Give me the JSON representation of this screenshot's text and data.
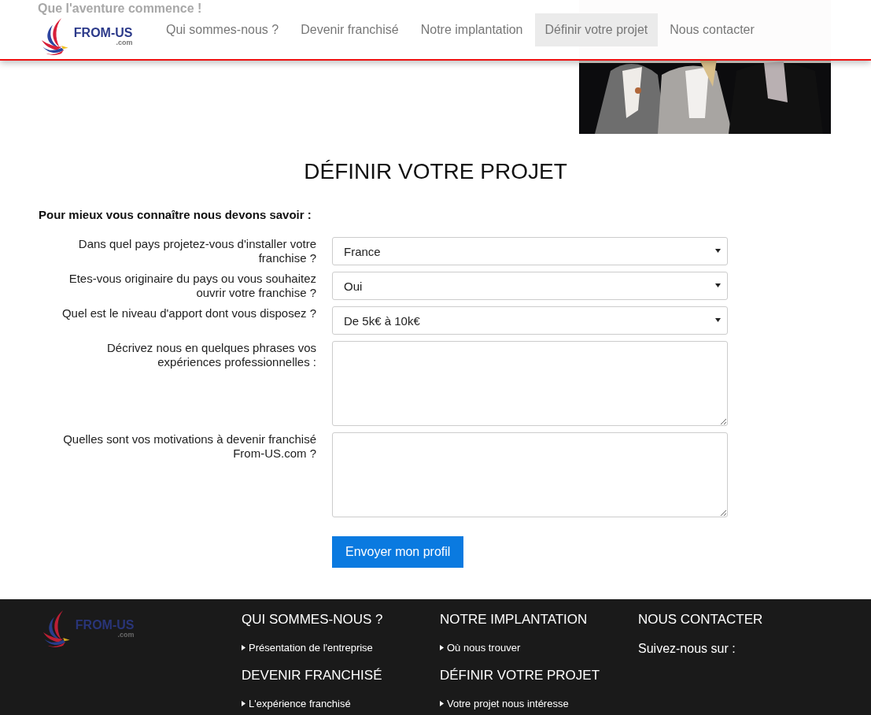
{
  "tagline": "Que l'aventure commence !",
  "logo": {
    "name": "FROM-US",
    "suffix": ".com"
  },
  "nav": [
    {
      "label": "Qui sommes-nous ?",
      "selected": false
    },
    {
      "label": "Devenir franchisé",
      "selected": false
    },
    {
      "label": "Notre implantation",
      "selected": false
    },
    {
      "label": "Définir votre projet",
      "selected": true
    },
    {
      "label": "Nous contacter",
      "selected": false
    }
  ],
  "title": "DÉFINIR VOTRE PROJET",
  "intro": "Pour mieux vous connaître nous devons savoir :",
  "fields": [
    {
      "kind": "select",
      "label": "Dans quel pays projetez-vous d'installer votre franchise ?",
      "value": "France"
    },
    {
      "kind": "select",
      "label": "Etes-vous originaire du pays ou vous souhaitez ouvrir votre franchise ?",
      "value": "Oui"
    },
    {
      "kind": "select",
      "label": "Quel est le niveau d'apport dont vous disposez ?",
      "value": "De 5k€ à 10k€"
    },
    {
      "kind": "textarea",
      "label": "Décrivez nous en quelques phrases vos expériences professionnelles :"
    },
    {
      "kind": "textarea",
      "label": "Quelles sont vos motivations à devenir franchisé From-US.com ?"
    }
  ],
  "submit": "Envoyer mon profil",
  "footer": {
    "logo": {
      "name": "FROM-US",
      "suffix": ".com"
    },
    "columns": [
      {
        "sections": [
          {
            "heading": "QUI SOMMES-NOUS ?",
            "links": [
              "Présentation de l'entreprise"
            ]
          },
          {
            "heading": "DEVENIR FRANCHISÉ",
            "links": [
              "L'expérience franchisé"
            ]
          }
        ]
      },
      {
        "sections": [
          {
            "heading": "NOTRE IMPLANTATION",
            "links": [
              "Où nous trouver"
            ]
          },
          {
            "heading": "DÉFINIR VOTRE PROJET",
            "links": [
              "Votre projet nous intéresse"
            ]
          }
        ]
      },
      {
        "sections": [
          {
            "heading": "NOUS CONTACTER",
            "text": "Suivez-nous sur :"
          }
        ]
      }
    ]
  }
}
